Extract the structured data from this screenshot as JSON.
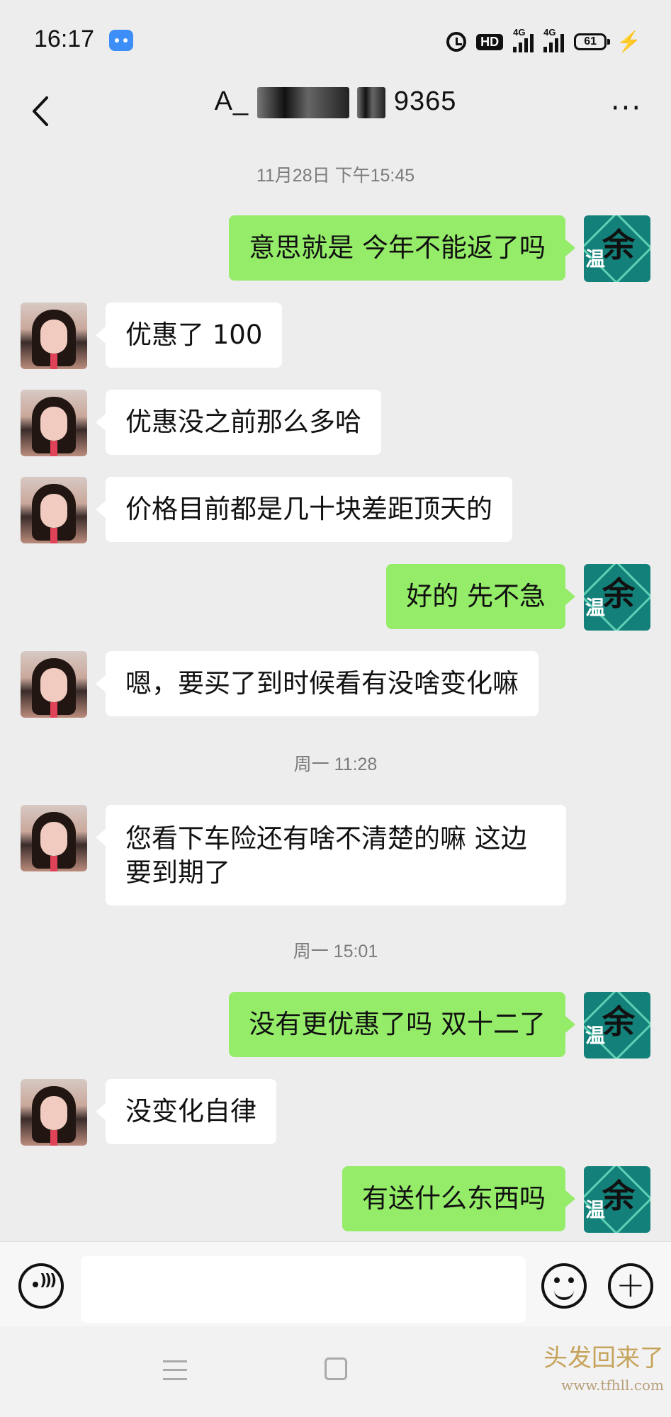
{
  "status_bar": {
    "time": "16:17",
    "network_1": "4G",
    "network_2": "4G",
    "hd_label": "HD",
    "battery": "61"
  },
  "header": {
    "title_prefix": "A_",
    "title_suffix": "9365"
  },
  "messages": [
    {
      "type": "timestamp",
      "text": "11月28日 下午15:45"
    },
    {
      "type": "out",
      "text": "意思就是 今年不能返了吗"
    },
    {
      "type": "in",
      "text": "优惠了 100"
    },
    {
      "type": "in",
      "text": "优惠没之前那么多哈"
    },
    {
      "type": "in",
      "text": "价格目前都是几十块差距顶天的"
    },
    {
      "type": "out",
      "text": "好的 先不急"
    },
    {
      "type": "in",
      "text": "嗯，要买了到时候看有没啥变化嘛"
    },
    {
      "type": "timestamp",
      "text": "周一 11:28"
    },
    {
      "type": "in",
      "text": "您看下车险还有啥不清楚的嘛  这边要到期了"
    },
    {
      "type": "timestamp",
      "text": "周一 15:01"
    },
    {
      "type": "out",
      "text": "没有更优惠了吗 双十二了"
    },
    {
      "type": "in",
      "text": "没变化自律"
    },
    {
      "type": "out",
      "text": "有送什么东西吗"
    }
  ],
  "avatar_right": {
    "glyph": "余",
    "glyph2": "温"
  },
  "input": {
    "value": ""
  },
  "watermark": {
    "text": "头发回来了",
    "url": "www.tfhll.com"
  },
  "colors": {
    "out_bubble": "#95ec69",
    "in_bubble": "#ffffff",
    "background": "#ededed"
  }
}
